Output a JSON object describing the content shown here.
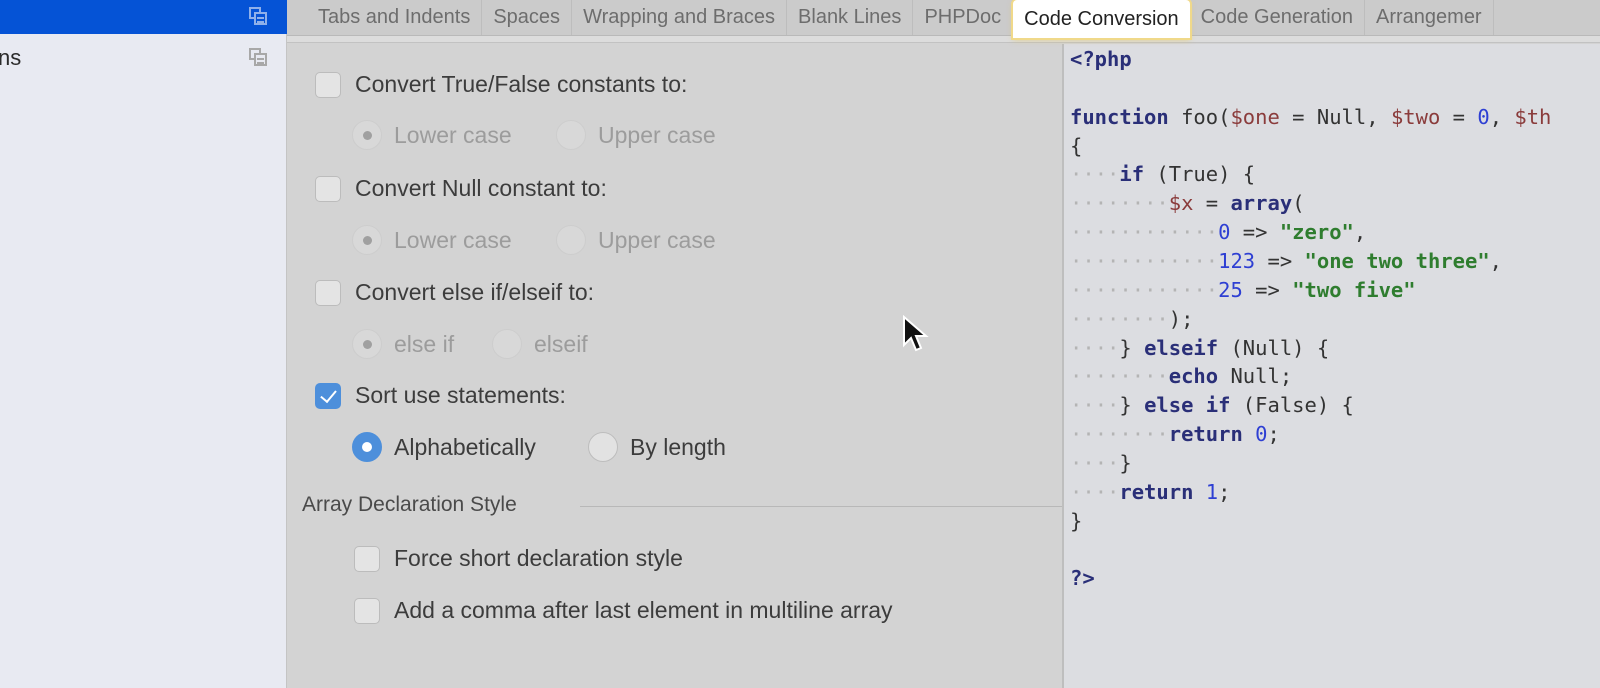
{
  "sidebar": {
    "items": [
      {
        "label": "",
        "selected": true,
        "icon": "copy-icon"
      },
      {
        "label": "ns",
        "selected": false,
        "icon": "copy-icon"
      }
    ]
  },
  "tabs": [
    {
      "label": "Tabs and Indents",
      "active": false
    },
    {
      "label": "Spaces",
      "active": false
    },
    {
      "label": "Wrapping and Braces",
      "active": false
    },
    {
      "label": "Blank Lines",
      "active": false
    },
    {
      "label": "PHPDoc",
      "active": false
    },
    {
      "label": "Code Conversion",
      "active": true
    },
    {
      "label": "Code Generation",
      "active": false
    },
    {
      "label": "Arrangemer",
      "active": false
    }
  ],
  "options": {
    "true_false": {
      "label": "Convert True/False constants to:",
      "checked": false,
      "choices": [
        "Lower case",
        "Upper case"
      ],
      "selected": "Lower case"
    },
    "null_const": {
      "label": "Convert Null constant to:",
      "checked": false,
      "choices": [
        "Lower case",
        "Upper case"
      ],
      "selected": "Lower case"
    },
    "else_if": {
      "label": "Convert else if/elseif to:",
      "checked": false,
      "choices": [
        "else if",
        "elseif"
      ],
      "selected": "else if"
    },
    "sort_use": {
      "label": "Sort use statements:",
      "checked": true,
      "choices": [
        "Alphabetically",
        "By length"
      ],
      "selected": "Alphabetically"
    },
    "array_group": {
      "title": "Array Declaration Style",
      "force_short": {
        "label": "Force short declaration style",
        "checked": false
      },
      "trailing_comma": {
        "label": "Add a comma after last element in multiline array",
        "checked": false
      }
    }
  },
  "preview": {
    "lines": [
      "<?php",
      "",
      "function foo($one = Null, $two = 0, $th",
      "{",
      "    if (True) {",
      "        $x = array(",
      "            0 => \"zero\",",
      "            123 => \"one two three\",",
      "            25 => \"two five\"",
      "        );",
      "    } elseif (Null) {",
      "        echo Null;",
      "    } else if (False) {",
      "        return 0;",
      "    }",
      "    return 1;",
      "}",
      "",
      "?>"
    ]
  },
  "colors": {
    "selection_blue": "#0553d6",
    "accent_blue": "#4d8fdb",
    "keyword": "#2a2f78",
    "variable": "#8a3b3b",
    "number": "#2e3fd3",
    "string": "#2f7d2f",
    "tab_highlight": "#f0d98a"
  }
}
